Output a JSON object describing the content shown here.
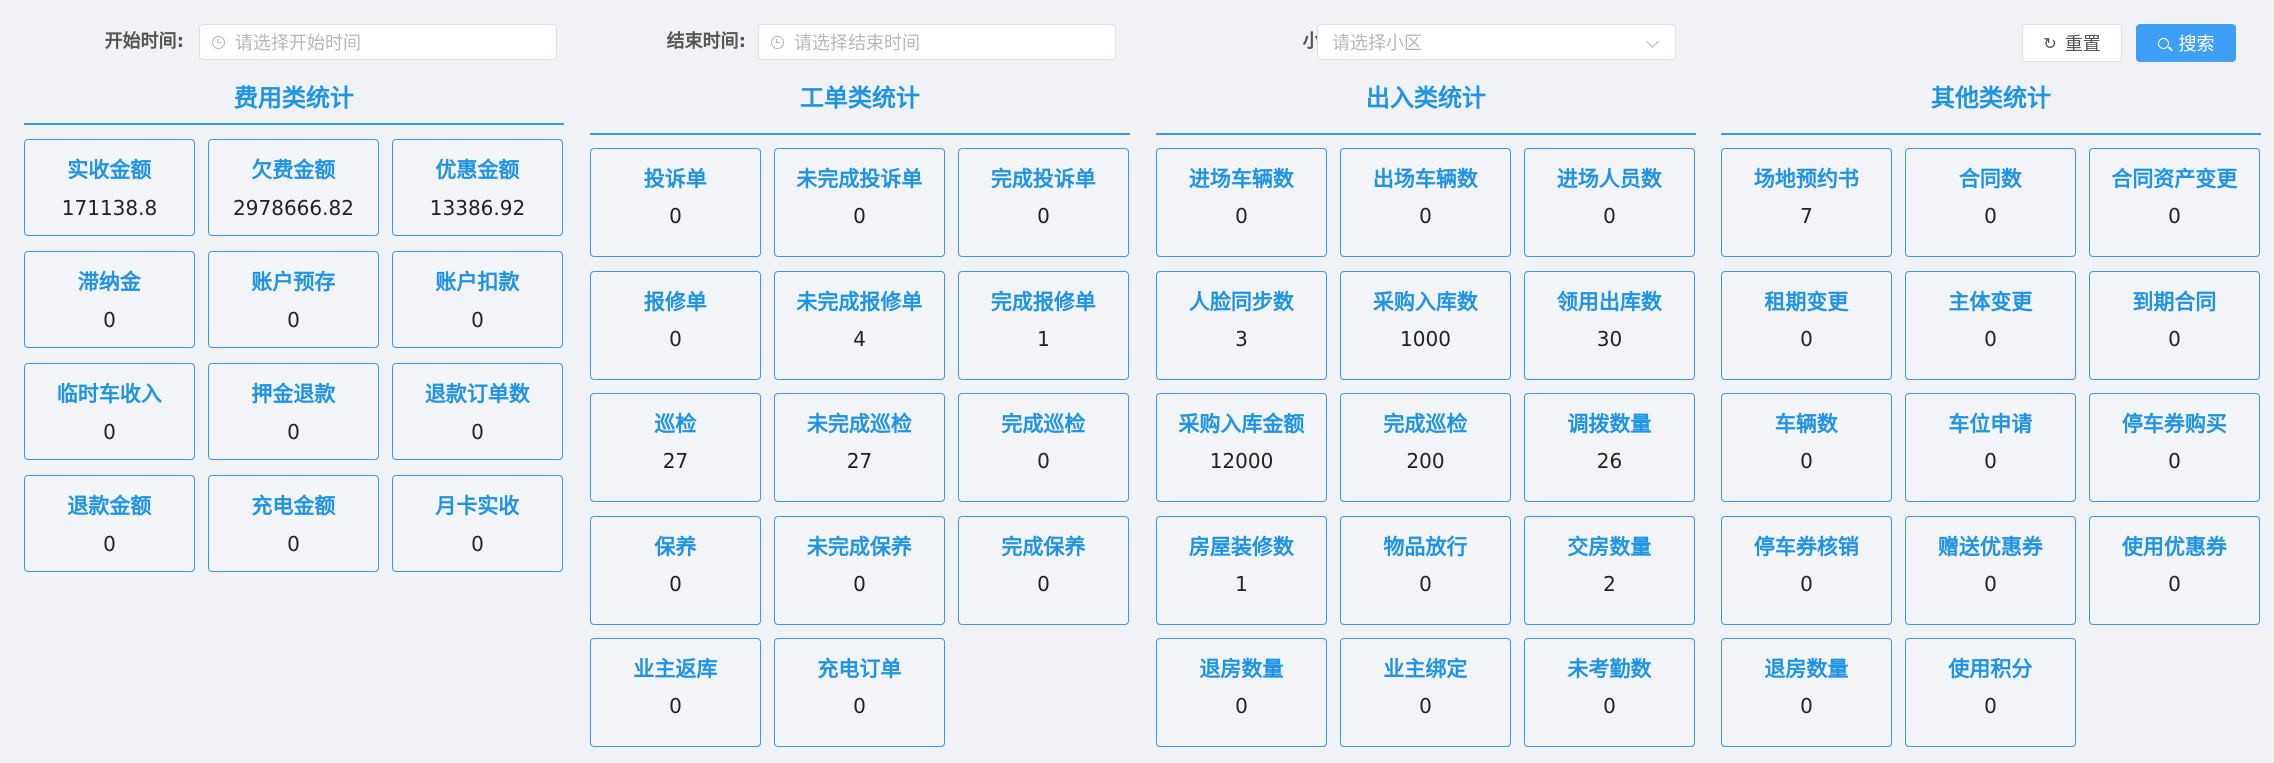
{
  "filters": {
    "start_label": "开始时间:",
    "start_placeholder": "请选择开始时间",
    "end_label": "结束时间:",
    "end_placeholder": "请选择结束时间",
    "community_label": "小区:",
    "community_placeholder": "请选择小区",
    "reset_label": "重置",
    "search_label": "搜索"
  },
  "sections": [
    {
      "title": "费用类统计",
      "cards": [
        {
          "label": "实收金额",
          "value": "171138.8"
        },
        {
          "label": "欠费金额",
          "value": "2978666.82"
        },
        {
          "label": "优惠金额",
          "value": "13386.92"
        },
        {
          "label": "滞纳金",
          "value": "0"
        },
        {
          "label": "账户预存",
          "value": "0"
        },
        {
          "label": "账户扣款",
          "value": "0"
        },
        {
          "label": "临时车收入",
          "value": "0"
        },
        {
          "label": "押金退款",
          "value": "0"
        },
        {
          "label": "退款订单数",
          "value": "0"
        },
        {
          "label": "退款金额",
          "value": "0"
        },
        {
          "label": "充电金额",
          "value": "0"
        },
        {
          "label": "月卡实收",
          "value": "0"
        }
      ]
    },
    {
      "title": "工单类统计",
      "cards": [
        {
          "label": "投诉单",
          "value": "0"
        },
        {
          "label": "未完成投诉单",
          "value": "0"
        },
        {
          "label": "完成投诉单",
          "value": "0"
        },
        {
          "label": "报修单",
          "value": "0"
        },
        {
          "label": "未完成报修单",
          "value": "4"
        },
        {
          "label": "完成报修单",
          "value": "1"
        },
        {
          "label": "巡检",
          "value": "27"
        },
        {
          "label": "未完成巡检",
          "value": "27"
        },
        {
          "label": "完成巡检",
          "value": "0"
        },
        {
          "label": "保养",
          "value": "0"
        },
        {
          "label": "未完成保养",
          "value": "0"
        },
        {
          "label": "完成保养",
          "value": "0"
        },
        {
          "label": "业主返库",
          "value": "0"
        },
        {
          "label": "充电订单",
          "value": "0"
        }
      ]
    },
    {
      "title": "出入类统计",
      "cards": [
        {
          "label": "进场车辆数",
          "value": "0"
        },
        {
          "label": "出场车辆数",
          "value": "0"
        },
        {
          "label": "进场人员数",
          "value": "0"
        },
        {
          "label": "人脸同步数",
          "value": "3"
        },
        {
          "label": "采购入库数",
          "value": "1000"
        },
        {
          "label": "领用出库数",
          "value": "30"
        },
        {
          "label": "采购入库金额",
          "value": "12000"
        },
        {
          "label": "完成巡检",
          "value": "200"
        },
        {
          "label": "调拨数量",
          "value": "26"
        },
        {
          "label": "房屋装修数",
          "value": "1"
        },
        {
          "label": "物品放行",
          "value": "0"
        },
        {
          "label": "交房数量",
          "value": "2"
        },
        {
          "label": "退房数量",
          "value": "0"
        },
        {
          "label": "业主绑定",
          "value": "0"
        },
        {
          "label": "未考勤数",
          "value": "0"
        }
      ]
    },
    {
      "title": "其他类统计",
      "cards": [
        {
          "label": "场地预约书",
          "value": "7"
        },
        {
          "label": "合同数",
          "value": "0"
        },
        {
          "label": "合同资产变更",
          "value": "0"
        },
        {
          "label": "租期变更",
          "value": "0"
        },
        {
          "label": "主体变更",
          "value": "0"
        },
        {
          "label": "到期合同",
          "value": "0"
        },
        {
          "label": "车辆数",
          "value": "0"
        },
        {
          "label": "车位申请",
          "value": "0"
        },
        {
          "label": "停车券购买",
          "value": "0"
        },
        {
          "label": "停车券核销",
          "value": "0"
        },
        {
          "label": "赠送优惠券",
          "value": "0"
        },
        {
          "label": "使用优惠券",
          "value": "0"
        },
        {
          "label": "退房数量",
          "value": "0"
        },
        {
          "label": "使用积分",
          "value": "0"
        }
      ]
    }
  ]
}
